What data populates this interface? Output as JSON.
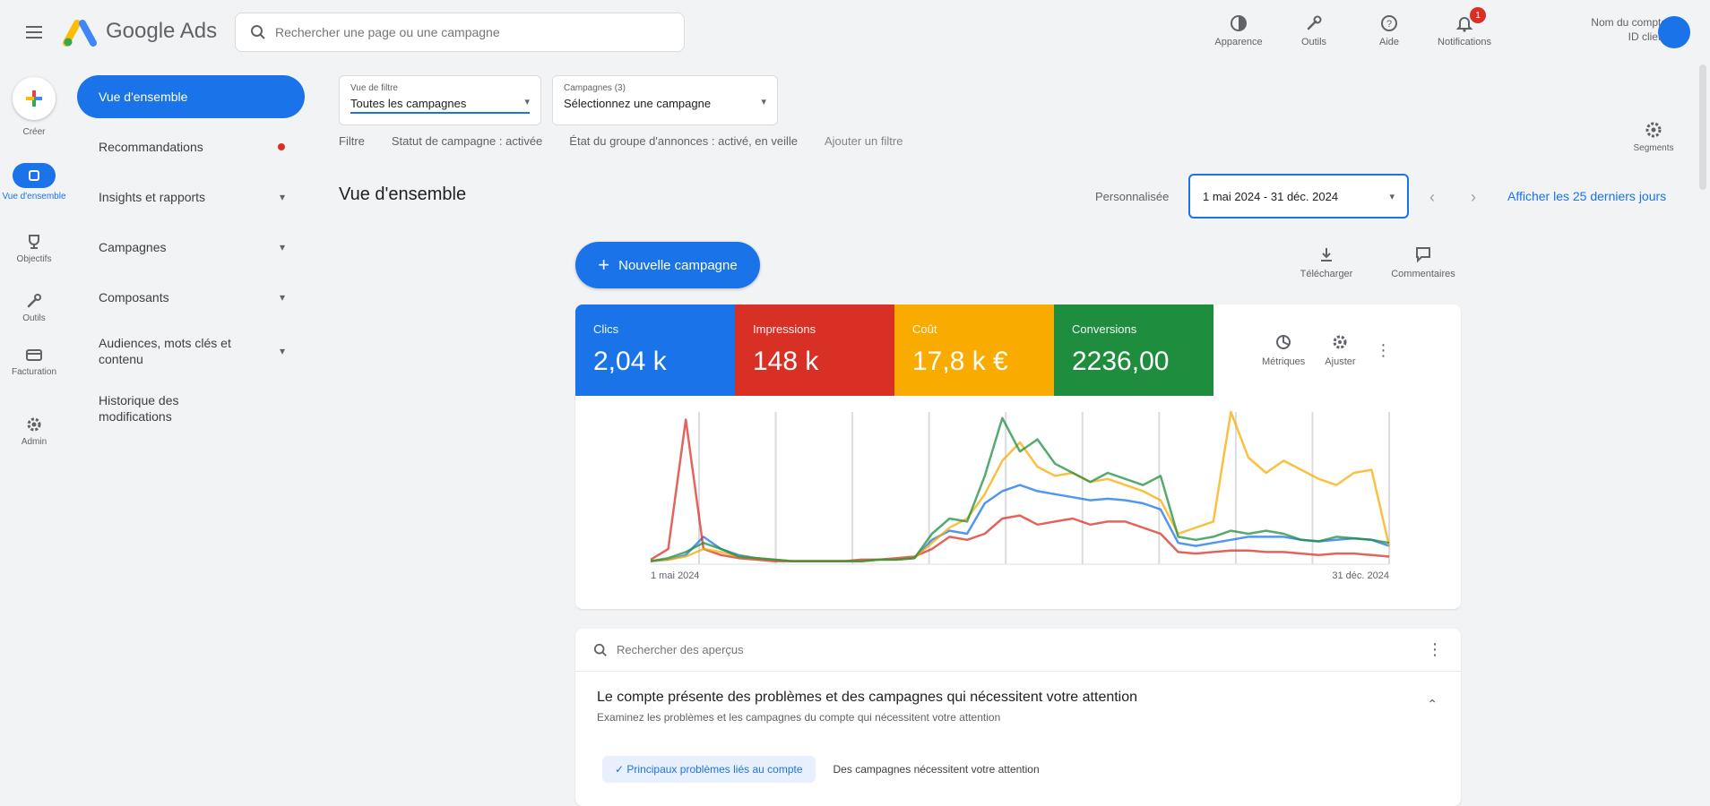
{
  "app": {
    "brand_name": "Google Ads",
    "search_placeholder": "Rechercher une page ou une campagne"
  },
  "top_actions": [
    {
      "label": "Apparence",
      "icon": "appearance-icon"
    },
    {
      "label": "Outils",
      "icon": "tools-icon"
    },
    {
      "label": "Aide",
      "icon": "help-icon"
    },
    {
      "label": "Notifications",
      "icon": "bell-icon",
      "badge": "1"
    }
  ],
  "account": {
    "line1": "Nom du compte",
    "line2": "ID client"
  },
  "rail": {
    "create_label": "Créer",
    "items": [
      {
        "label": "Vue d'ensemble",
        "icon": "campaigns-icon",
        "active": true
      },
      {
        "label": "Objectifs",
        "icon": "trophy-icon"
      },
      {
        "label": "Outils",
        "icon": "tools-icon"
      },
      {
        "label": "Facturation",
        "icon": "billing-icon"
      },
      {
        "label": "Admin",
        "icon": "gear-icon"
      }
    ]
  },
  "nav": {
    "items": [
      {
        "label": "Vue d'ensemble",
        "active": true
      },
      {
        "label": "Recommandations",
        "dot": true
      },
      {
        "label": "Insights et rapports",
        "chevron": true
      },
      {
        "label": "Campagnes",
        "chevron": true
      },
      {
        "label": "Composants",
        "chevron": true
      },
      {
        "label": "Audiences, mots clés et contenu",
        "chevron": true
      },
      {
        "label": "Historique des modifications"
      }
    ]
  },
  "filters": {
    "workspace_key": "Vue de filtre",
    "workspace_value": "Toutes les campagnes",
    "campaigns_key": "Campagnes (3)",
    "campaigns_value": "Sélectionnez une campagne",
    "label": "Filtre",
    "chip1": "Statut de campagne : activée",
    "chip2": "État du groupe d'annonces : activé, en veille",
    "add_filter": "Ajouter un filtre",
    "settings_label": "Segments"
  },
  "header": {
    "title": "Vue d'ensemble",
    "custom_label": "Personnalisée",
    "date_range": "1 mai 2024 - 31 déc. 2024",
    "show_link": "Afficher les 25 derniers jours"
  },
  "toolbar": {
    "new_campaign": "Nouvelle campagne",
    "tool1": "Télécharger",
    "tool2": "Commentaires"
  },
  "metrics": [
    {
      "label": "Clics",
      "value": "2,04 k",
      "color": "#1a73e8"
    },
    {
      "label": "Impressions",
      "value": "148 k",
      "color": "#d93025"
    },
    {
      "label": "Coût",
      "value": "17,8 k €",
      "color": "#f9ab00"
    },
    {
      "label": "Conversions",
      "value": "2236,00",
      "color": "#1e8e3e"
    }
  ],
  "metric_tools": {
    "tool1": "Métriques",
    "tool2": "Ajuster"
  },
  "chart_data": {
    "type": "line",
    "x_start_label": "1 mai 2024",
    "x_end_label": "31 déc. 2024",
    "series": [
      {
        "name": "Clics",
        "color": "#1a73e8",
        "values": [
          2,
          3,
          6,
          18,
          10,
          6,
          4,
          3,
          2,
          2,
          2,
          2,
          2,
          3,
          3,
          4,
          16,
          22,
          20,
          40,
          48,
          52,
          48,
          46,
          44,
          42,
          43,
          42,
          40,
          36,
          14,
          12,
          14,
          16,
          18,
          18,
          18,
          16,
          15,
          16,
          17,
          16,
          12
        ]
      },
      {
        "name": "Impressions",
        "color": "#d93025",
        "values": [
          3,
          10,
          95,
          10,
          6,
          4,
          3,
          2,
          2,
          2,
          2,
          2,
          3,
          3,
          4,
          5,
          10,
          18,
          16,
          20,
          30,
          32,
          26,
          28,
          30,
          26,
          28,
          28,
          24,
          20,
          8,
          7,
          8,
          9,
          9,
          8,
          8,
          7,
          6,
          7,
          7,
          6,
          5
        ]
      },
      {
        "name": "Coût",
        "color": "#f9ab00",
        "values": [
          2,
          3,
          5,
          10,
          8,
          5,
          4,
          3,
          2,
          2,
          2,
          2,
          2,
          3,
          3,
          4,
          14,
          24,
          30,
          46,
          68,
          80,
          64,
          58,
          60,
          54,
          56,
          52,
          48,
          42,
          20,
          24,
          28,
          100,
          70,
          60,
          68,
          62,
          56,
          52,
          60,
          62,
          12
        ]
      },
      {
        "name": "Conversions",
        "color": "#1e8e3e",
        "values": [
          2,
          4,
          8,
          14,
          10,
          5,
          4,
          3,
          2,
          2,
          2,
          2,
          2,
          3,
          3,
          4,
          20,
          30,
          28,
          58,
          96,
          74,
          82,
          66,
          60,
          54,
          60,
          56,
          52,
          58,
          18,
          16,
          18,
          22,
          20,
          22,
          20,
          16,
          15,
          18,
          17,
          16,
          14
        ]
      }
    ]
  },
  "issues": {
    "search_placeholder": "Rechercher des aperçus",
    "title": "Le compte présente des problèmes et des campagnes qui nécessitent votre attention",
    "subtitle": "Examinez les problèmes et les campagnes du compte qui nécessitent votre attention",
    "tab1": "Principaux problèmes liés au compte",
    "tab2": "Des campagnes nécessitent votre attention"
  }
}
